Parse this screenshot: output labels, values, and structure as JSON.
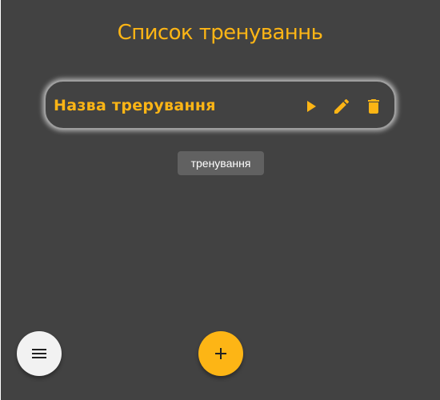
{
  "header": {
    "title": "Список тренуваннь"
  },
  "workouts": [
    {
      "name": "Назва трерування",
      "actions": {
        "play_icon": "play-arrow",
        "edit_icon": "pencil",
        "delete_icon": "trash-can"
      }
    }
  ],
  "tooltip": {
    "text": "тренування"
  },
  "fabs": {
    "menu_icon": "hamburger-menu",
    "add_icon": "plus"
  },
  "colors": {
    "background": "#424242",
    "accent": "#fdb515",
    "tooltip_bg": "#616161",
    "menu_fab_bg": "#f2f2f2"
  }
}
